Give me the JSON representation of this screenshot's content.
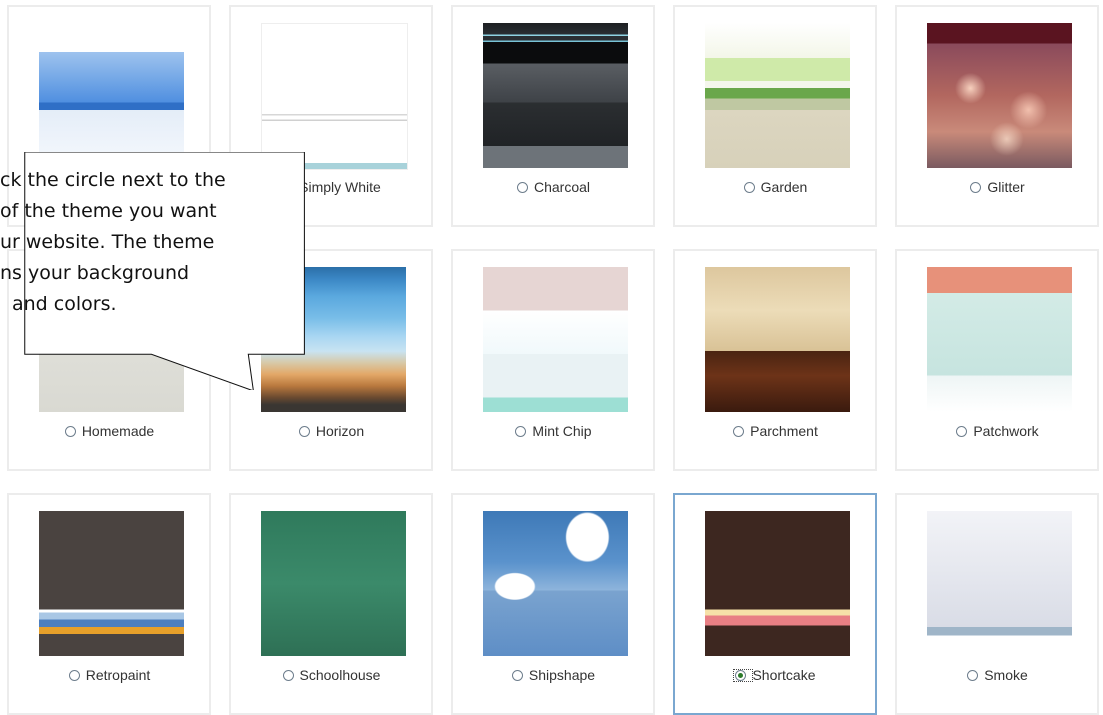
{
  "themes": [
    {
      "name": "",
      "selected": false
    },
    {
      "name": "Simply White",
      "selected": false
    },
    {
      "name": "Charcoal",
      "selected": false
    },
    {
      "name": "Garden",
      "selected": false
    },
    {
      "name": "Glitter",
      "selected": false
    },
    {
      "name": "Homemade",
      "selected": false
    },
    {
      "name": "Horizon",
      "selected": false
    },
    {
      "name": "Mint Chip",
      "selected": false
    },
    {
      "name": "Parchment",
      "selected": false
    },
    {
      "name": "Patchwork",
      "selected": false
    },
    {
      "name": "Retropaint",
      "selected": false
    },
    {
      "name": "Schoolhouse",
      "selected": false
    },
    {
      "name": "Shipshape",
      "selected": false
    },
    {
      "name": "Shortcake",
      "selected": true
    },
    {
      "name": "Smoke",
      "selected": false
    }
  ],
  "callout": {
    "lines": [
      "ck the circle next to the",
      "of the theme you want",
      "ur website. The theme",
      "ns your background",
      "and colors."
    ]
  },
  "colors": {
    "selected_border": "#7aa7d0",
    "card_border": "#ececec",
    "radio_checked": "#2b7a2b"
  }
}
